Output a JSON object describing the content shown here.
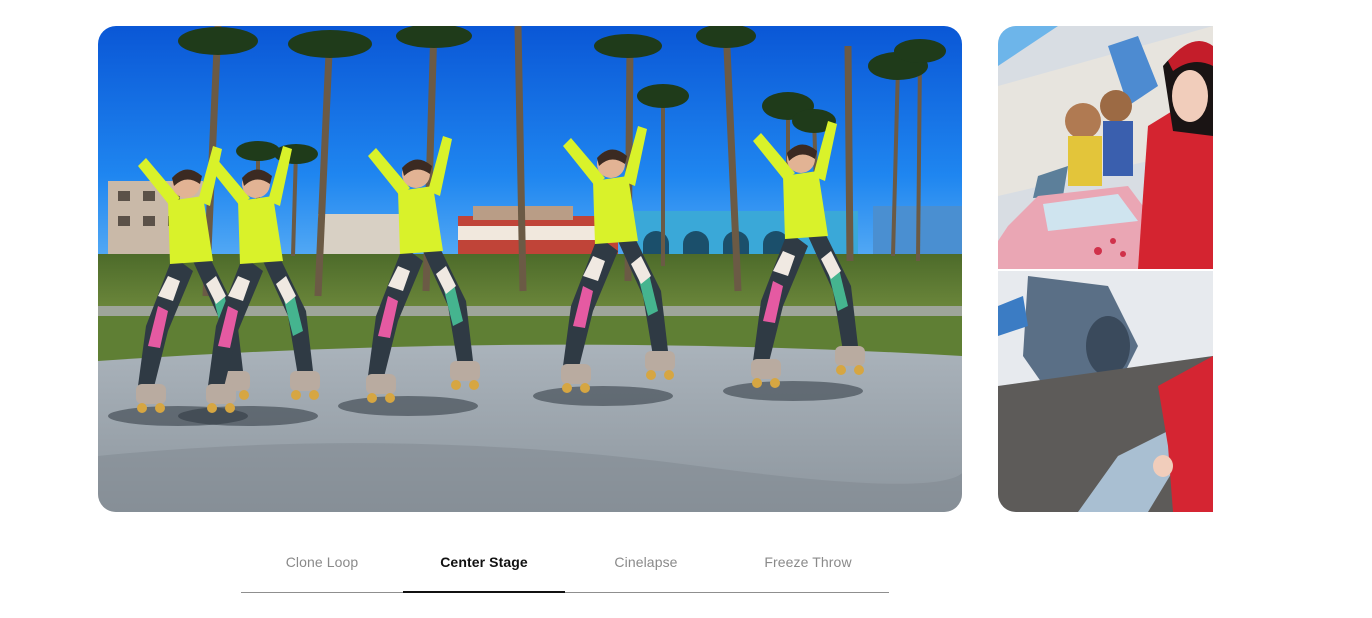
{
  "carousel": {
    "main_slide_alt": "Roller skater cloned four times in a park with palm trees",
    "next_slide_alt": "Person in red hoodie in front of mural with pink car"
  },
  "tabs": [
    {
      "label": "Clone Loop",
      "active": false
    },
    {
      "label": "Center Stage",
      "active": true
    },
    {
      "label": "Cinelapse",
      "active": false
    },
    {
      "label": "Freeze Throw",
      "active": false
    }
  ],
  "colors": {
    "active_text": "#111111",
    "inactive_text": "#8a8a8a",
    "divider": "#8f8f8f"
  }
}
